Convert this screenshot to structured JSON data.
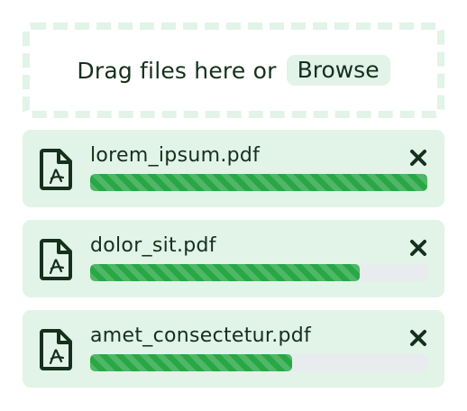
{
  "dropzone": {
    "text": "Drag files here or",
    "browse_label": "Browse"
  },
  "files": [
    {
      "name": "lorem_ipsum.pdf",
      "progress": 1.0,
      "icon": "pdf-file-icon"
    },
    {
      "name": "dolor_sit.pdf",
      "progress": 0.8,
      "icon": "pdf-file-icon"
    },
    {
      "name": "amet_consectetur.pdf",
      "progress": 0.6,
      "icon": "pdf-file-icon"
    }
  ],
  "colors": {
    "accent": "#28a745",
    "card_background": "#e2f3e7",
    "text": "#15301c",
    "track": "#e8ecef"
  }
}
